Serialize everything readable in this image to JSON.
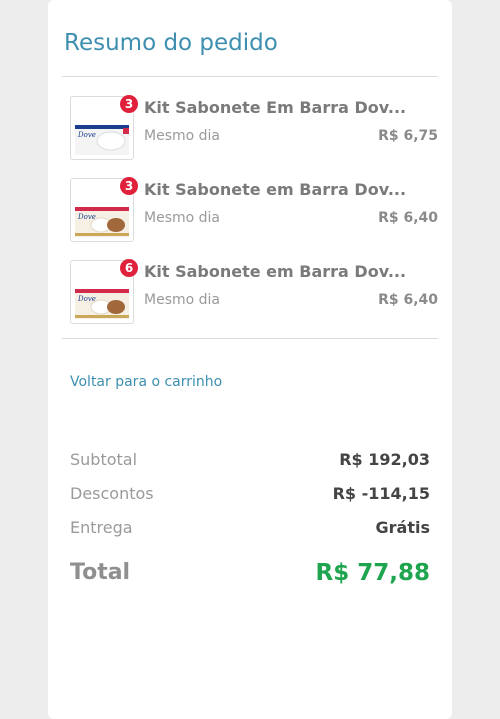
{
  "summary": {
    "title": "Resumo do pedido",
    "items": [
      {
        "name": "Kit Sabonete Em Barra Dov...",
        "quantity": "3",
        "delivery": "Mesmo dia",
        "price": "R$ 6,75",
        "thumbnail_icon": "soap-kit-box-icon"
      },
      {
        "name": "Kit Sabonete em Barra Dov...",
        "quantity": "3",
        "delivery": "Mesmo dia",
        "price": "R$ 6,40",
        "thumbnail_icon": "soap-kit-box-icon"
      },
      {
        "name": "Kit Sabonete em Barra Dov...",
        "quantity": "6",
        "delivery": "Mesmo dia",
        "price": "R$ 6,40",
        "thumbnail_icon": "soap-kit-box-icon"
      }
    ],
    "back_link": "Voltar para o carrinho",
    "totals": {
      "subtotal_label": "Subtotal",
      "subtotal_value": "R$ 192,03",
      "discount_label": "Descontos",
      "discount_value": "R$ -114,15",
      "delivery_label": "Entrega",
      "delivery_value": "Grátis",
      "total_label": "Total",
      "total_value": "R$ 77,88"
    }
  },
  "colors": {
    "accent": "#3e8fb0",
    "badge": "#e0213c",
    "total_green": "#1fa44f",
    "background": "#ededed",
    "card": "#ffffff"
  }
}
